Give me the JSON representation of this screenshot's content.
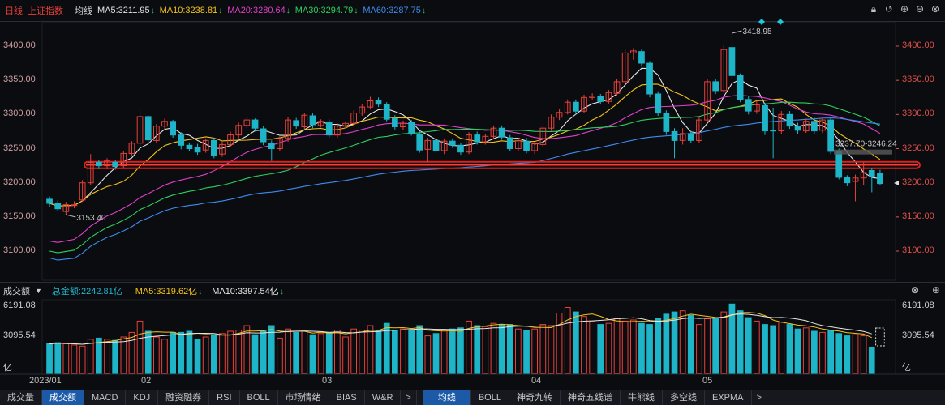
{
  "header": {
    "period": "日线",
    "index_name": "上证指数",
    "ma_mode": "均线",
    "ma": [
      {
        "label": "MA5:3211.95",
        "color": "#e6e6e6"
      },
      {
        "label": "MA10:3238.81",
        "color": "#f2c21b"
      },
      {
        "label": "MA20:3280.64",
        "color": "#e040c8"
      },
      {
        "label": "MA30:3294.79",
        "color": "#2ecf5e"
      },
      {
        "label": "MA60:3287.75",
        "color": "#3f8bf0"
      }
    ],
    "icons": [
      "lock-icon",
      "undo-icon",
      "zoom-in-icon",
      "zoom-out-icon",
      "close-icon"
    ]
  },
  "price_axis": {
    "ticks": [
      "3400.00",
      "3350.00",
      "3300.00",
      "3250.00",
      "3200.00",
      "3150.00",
      "3100.00"
    ],
    "tick_values": [
      3400,
      3350,
      3300,
      3250,
      3200,
      3150,
      3100
    ],
    "range": [
      3082,
      3455
    ]
  },
  "annotations": {
    "high_label": "3418.95",
    "low_label": "3153.40",
    "range_label": "3237.70-3246.24"
  },
  "volume_header": {
    "title": "成交额",
    "total": "总金额:2242.81亿",
    "ma5": "MA5:3319.62亿",
    "ma10": "MA10:3397.54亿"
  },
  "volume_axis": {
    "ticks": [
      "6191.08",
      "3095.54"
    ],
    "unit": "亿",
    "max": 6191.08
  },
  "x_axis": [
    "2023/01",
    "02",
    "03",
    "04",
    "05"
  ],
  "tabs_left": [
    "成交量",
    "成交额",
    "MACD",
    "KDJ",
    "融资融券",
    "RSI",
    "BOLL",
    "市场情绪",
    "BIAS",
    "W&R"
  ],
  "tabs_right": [
    "均线",
    "BOLL",
    "神奇九转",
    "神奇五线谱",
    "牛熊线",
    "多空线",
    "EXPMA"
  ],
  "active_left": "成交额",
  "active_right": "均线",
  "colors": {
    "up": "#e8403a",
    "down": "#1fb5c8",
    "bg": "#0b0c10"
  },
  "chart_data": {
    "type": "candlestick",
    "title": "上证指数 日线",
    "candles": [
      [
        3176,
        3170,
        3180,
        3165
      ],
      [
        3170,
        3162,
        3174,
        3158
      ],
      [
        3158,
        3168,
        3172,
        3153
      ],
      [
        3168,
        3168,
        3173,
        3163
      ],
      [
        3175,
        3200,
        3204,
        3172
      ],
      [
        3200,
        3230,
        3242,
        3196
      ],
      [
        3230,
        3225,
        3234,
        3220
      ],
      [
        3225,
        3232,
        3236,
        3220
      ],
      [
        3230,
        3224,
        3233,
        3219
      ],
      [
        3225,
        3243,
        3246,
        3222
      ],
      [
        3243,
        3258,
        3261,
        3240
      ],
      [
        3258,
        3297,
        3306,
        3253
      ],
      [
        3297,
        3263,
        3299,
        3260
      ],
      [
        3262,
        3283,
        3286,
        3258
      ],
      [
        3283,
        3290,
        3294,
        3278
      ],
      [
        3290,
        3270,
        3292,
        3266
      ],
      [
        3270,
        3255,
        3274,
        3249
      ],
      [
        3255,
        3250,
        3259,
        3246
      ],
      [
        3252,
        3245,
        3257,
        3241
      ],
      [
        3248,
        3262,
        3265,
        3244
      ],
      [
        3262,
        3240,
        3266,
        3236
      ],
      [
        3242,
        3256,
        3260,
        3238
      ],
      [
        3256,
        3270,
        3275,
        3252
      ],
      [
        3270,
        3284,
        3288,
        3265
      ],
      [
        3284,
        3292,
        3297,
        3280
      ],
      [
        3292,
        3280,
        3294,
        3275
      ],
      [
        3279,
        3260,
        3283,
        3255
      ],
      [
        3258,
        3250,
        3262,
        3232
      ],
      [
        3250,
        3265,
        3268,
        3246
      ],
      [
        3265,
        3292,
        3296,
        3260
      ],
      [
        3291,
        3283,
        3295,
        3279
      ],
      [
        3282,
        3299,
        3302,
        3279
      ],
      [
        3298,
        3285,
        3302,
        3280
      ],
      [
        3284,
        3290,
        3293,
        3281
      ],
      [
        3289,
        3270,
        3293,
        3266
      ],
      [
        3270,
        3283,
        3287,
        3266
      ],
      [
        3283,
        3287,
        3290,
        3280
      ],
      [
        3287,
        3302,
        3306,
        3284
      ],
      [
        3302,
        3311,
        3315,
        3298
      ],
      [
        3311,
        3320,
        3326,
        3308
      ],
      [
        3320,
        3315,
        3325,
        3311
      ],
      [
        3314,
        3293,
        3318,
        3290
      ],
      [
        3294,
        3282,
        3299,
        3278
      ],
      [
        3282,
        3287,
        3291,
        3278
      ],
      [
        3288,
        3272,
        3292,
        3269
      ],
      [
        3271,
        3248,
        3276,
        3244
      ],
      [
        3249,
        3262,
        3266,
        3230
      ],
      [
        3262,
        3247,
        3266,
        3243
      ],
      [
        3247,
        3261,
        3265,
        3242
      ],
      [
        3261,
        3255,
        3265,
        3251
      ],
      [
        3255,
        3245,
        3259,
        3241
      ],
      [
        3245,
        3270,
        3274,
        3242
      ],
      [
        3270,
        3260,
        3275,
        3256
      ],
      [
        3260,
        3268,
        3272,
        3256
      ],
      [
        3268,
        3280,
        3284,
        3264
      ],
      [
        3280,
        3267,
        3284,
        3263
      ],
      [
        3266,
        3250,
        3270,
        3246
      ],
      [
        3250,
        3262,
        3266,
        3247
      ],
      [
        3261,
        3247,
        3266,
        3243
      ],
      [
        3247,
        3257,
        3260,
        3242
      ],
      [
        3256,
        3280,
        3284,
        3253
      ],
      [
        3280,
        3296,
        3300,
        3276
      ],
      [
        3296,
        3303,
        3308,
        3292
      ],
      [
        3303,
        3318,
        3322,
        3300
      ],
      [
        3318,
        3305,
        3322,
        3300
      ],
      [
        3305,
        3325,
        3329,
        3302
      ],
      [
        3325,
        3327,
        3331,
        3322
      ],
      [
        3327,
        3319,
        3330,
        3315
      ],
      [
        3319,
        3332,
        3336,
        3316
      ],
      [
        3331,
        3348,
        3352,
        3327
      ],
      [
        3348,
        3390,
        3395,
        3343
      ],
      [
        3390,
        3393,
        3397,
        3380
      ],
      [
        3392,
        3375,
        3395,
        3370
      ],
      [
        3375,
        3330,
        3378,
        3325
      ],
      [
        3330,
        3302,
        3334,
        3298
      ],
      [
        3302,
        3275,
        3306,
        3270
      ],
      [
        3275,
        3262,
        3280,
        3236
      ],
      [
        3262,
        3272,
        3280,
        3256
      ],
      [
        3272,
        3262,
        3276,
        3258
      ],
      [
        3262,
        3292,
        3297,
        3258
      ],
      [
        3292,
        3348,
        3352,
        3288
      ],
      [
        3348,
        3335,
        3352,
        3330
      ],
      [
        3335,
        3395,
        3402,
        3331
      ],
      [
        3398,
        3357,
        3418,
        3352
      ],
      [
        3357,
        3322,
        3360,
        3318
      ],
      [
        3322,
        3305,
        3327,
        3300
      ],
      [
        3305,
        3314,
        3320,
        3301
      ],
      [
        3313,
        3276,
        3317,
        3270
      ],
      [
        3277,
        3276,
        3310,
        3236
      ],
      [
        3276,
        3300,
        3305,
        3272
      ],
      [
        3300,
        3283,
        3305,
        3279
      ],
      [
        3283,
        3277,
        3288,
        3272
      ],
      [
        3276,
        3290,
        3294,
        3273
      ],
      [
        3290,
        3276,
        3296,
        3271
      ],
      [
        3277,
        3292,
        3295,
        3273
      ],
      [
        3292,
        3246,
        3296,
        3242
      ],
      [
        3246,
        3208,
        3250,
        3205
      ],
      [
        3208,
        3200,
        3211,
        3195
      ],
      [
        3202,
        3207,
        3212,
        3173
      ],
      [
        3207,
        3215,
        3230,
        3197
      ],
      [
        3218,
        3209,
        3222,
        3186
      ],
      [
        3214,
        3199,
        3219,
        3196
      ]
    ],
    "volume": [
      2600,
      2700,
      2600,
      2500,
      2400,
      3000,
      3100,
      3000,
      2900,
      3200,
      3600,
      4600,
      3700,
      3200,
      3000,
      3600,
      3600,
      3700,
      3000,
      3200,
      3400,
      3500,
      3700,
      3800,
      4200,
      3400,
      3700,
      4200,
      3100,
      3900,
      3600,
      3700,
      3400,
      3500,
      3500,
      3800,
      3200,
      3900,
      3800,
      4200,
      3800,
      4400,
      3800,
      3900,
      3800,
      4200,
      3300,
      3500,
      3800,
      3900,
      4000,
      4600,
      4200,
      4100,
      4400,
      4300,
      4300,
      3900,
      3800,
      3900,
      4300,
      4200,
      5300,
      5800,
      5400,
      5000,
      4600,
      4300,
      4400,
      4800,
      4600,
      4700,
      4400,
      4300,
      4800,
      5200,
      5400,
      5500,
      5100,
      4300,
      4800,
      4900,
      5400,
      6100,
      5500,
      4900,
      4600,
      4300,
      4200,
      4500,
      4300,
      3900,
      4000,
      3700,
      3600,
      3800,
      3500,
      3300,
      3400,
      3300,
      2242
    ],
    "series": [
      {
        "name": "MA5",
        "color": "#e6e6e6",
        "last": 3211.95
      },
      {
        "name": "MA10",
        "color": "#f2c21b",
        "last": 3238.81
      },
      {
        "name": "MA20",
        "color": "#e040c8",
        "last": 3280.64
      },
      {
        "name": "MA30",
        "color": "#2ecf5e",
        "last": 3294.79
      },
      {
        "name": "MA60",
        "color": "#3f8bf0",
        "last": 3287.75
      }
    ],
    "support_line": 3226,
    "ylim": [
      3082,
      3455
    ]
  }
}
